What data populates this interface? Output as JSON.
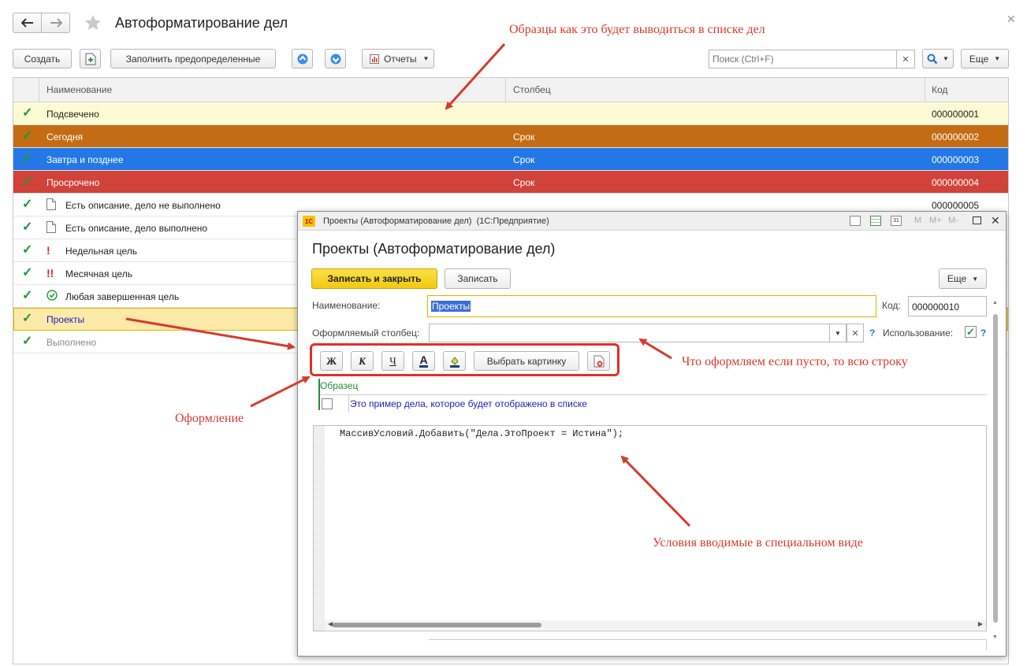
{
  "window": {
    "title": "Автоформатирование дел",
    "back_icon": "arrow-left-icon",
    "forward_icon": "arrow-right-icon",
    "favorite_icon": "star-icon"
  },
  "toolbar": {
    "create_label": "Создать",
    "fill_label": "Заполнить предопределенные",
    "reports_label": "Отчеты",
    "search_placeholder": "Поиск (Ctrl+F)",
    "more_label": "Еще"
  },
  "table": {
    "columns": [
      "Наименование",
      "Столбец",
      "Код"
    ],
    "rows": [
      {
        "name": "Подсвечено",
        "column": "",
        "code": "000000001",
        "bg": "#fdfbd3",
        "color": "#222222",
        "icon": ""
      },
      {
        "name": "Сегодня",
        "column": "Срок",
        "code": "000000002",
        "bg": "#c46c14",
        "color": "#ffffff",
        "icon": ""
      },
      {
        "name": "Завтра и позднее",
        "column": "Срок",
        "code": "000000003",
        "bg": "#2378e6",
        "color": "#ffffff",
        "icon": ""
      },
      {
        "name": "Просрочено",
        "column": "Срок",
        "code": "000000004",
        "bg": "#d0423a",
        "color": "#ffffff",
        "icon": ""
      },
      {
        "name": "Есть описание, дело не выполнено",
        "column": "",
        "code": "000000005",
        "bg": "#ffffff",
        "color": "#222222",
        "icon": "document-icon"
      },
      {
        "name": "Есть описание, дело выполнено",
        "column": "",
        "code": "",
        "bg": "#ffffff",
        "color": "#222222",
        "icon": "document-icon"
      },
      {
        "name": "Недельная цель",
        "column": "",
        "code": "",
        "bg": "#ffffff",
        "color": "#222222",
        "icon": "exclamation-icon"
      },
      {
        "name": "Месячная цель",
        "column": "",
        "code": "",
        "bg": "#ffffff",
        "color": "#222222",
        "icon": "double-exclamation-icon"
      },
      {
        "name": "Любая завершенная цель",
        "column": "",
        "code": "",
        "bg": "#ffffff",
        "color": "#222222",
        "icon": "check-circle-icon"
      },
      {
        "name": "Проекты",
        "column": "",
        "code": "",
        "bg": "#fde9a8",
        "color": "#1d1dbf",
        "icon": ""
      },
      {
        "name": "Выполнено",
        "column": "",
        "code": "",
        "bg": "#ffffff",
        "color": "#8a8a8a",
        "icon": ""
      }
    ]
  },
  "dialog": {
    "titlebar": "Проекты (Автоформатирование дел)  (1С:Предприятие)",
    "heading": "Проекты (Автоформатирование дел)",
    "save_close_label": "Записать и закрыть",
    "save_label": "Записать",
    "more_label": "Еще",
    "name_label": "Наименование:",
    "name_value": "Проекты",
    "code_label": "Код:",
    "code_value": "000000010",
    "column_label": "Оформляемый столбец:",
    "usage_label": "Использование:",
    "help_mark": "?",
    "format_buttons": {
      "bold": "Ж",
      "italic": "К",
      "underline": "Ч",
      "text_color": "A"
    },
    "choose_picture_label": "Выбрать картинку",
    "sample_header": "Образец",
    "sample_text": "Это пример дела, которое будет отображено в списке",
    "code_text": "МассивУсловий.Добавить(\"Дела.ЭтоПроект = Истина\");"
  },
  "annotations": {
    "samples": "Образцы как это будет выводиться в списке дел",
    "format_what": "Что оформляем если пусто, то всю строку",
    "formatting": "Оформление",
    "conditions": "Условия вводимые в специальном виде"
  },
  "colors": {
    "accent_yellow": "#f7d417",
    "annotation_red": "#d63a2e",
    "check_green": "#1a9a3a"
  }
}
